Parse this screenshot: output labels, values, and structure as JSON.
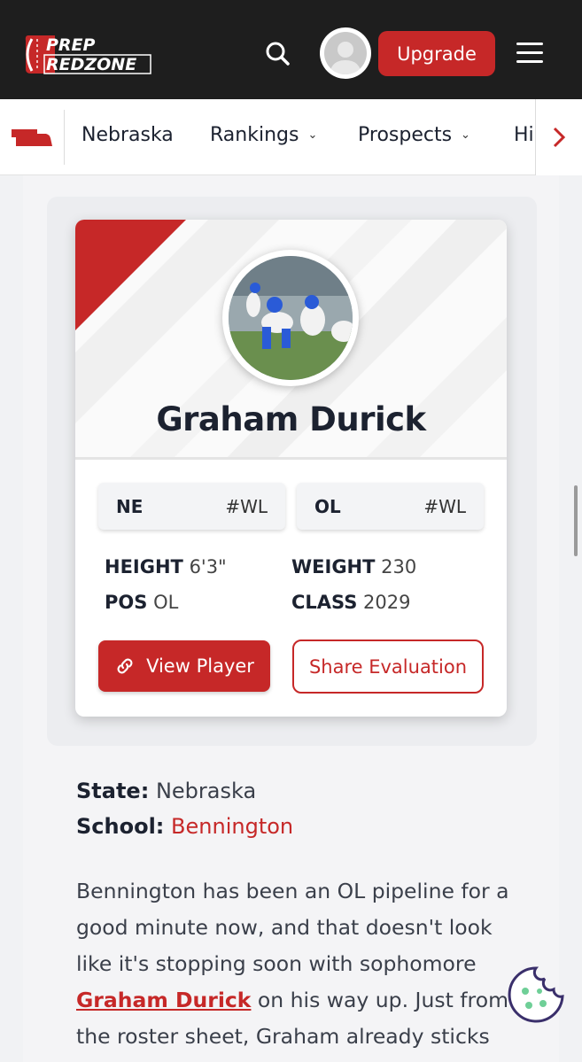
{
  "header": {
    "logo_line1": "PREP",
    "logo_line2": "REDZONE",
    "upgrade_label": "Upgrade",
    "icons": [
      "search-icon",
      "avatar-icon",
      "hamburger-menu-icon"
    ]
  },
  "nav": {
    "items": [
      {
        "label": "Nebraska",
        "has_dropdown": false
      },
      {
        "label": "Rankings",
        "has_dropdown": true
      },
      {
        "label": "Prospects",
        "has_dropdown": true
      },
      {
        "label": "Hi",
        "has_dropdown": false
      }
    ],
    "icons": [
      "nebraska-state-icon",
      "chevron-right-icon"
    ]
  },
  "player": {
    "name": "Graham Durick",
    "chips": [
      {
        "label": "NE",
        "rank": "#WL"
      },
      {
        "label": "OL",
        "rank": "#WL"
      }
    ],
    "stats": {
      "height_label": "HEIGHT",
      "height_value": "6'3\"",
      "weight_label": "WEIGHT",
      "weight_value": "230",
      "pos_label": "POS",
      "pos_value": "OL",
      "class_label": "CLASS",
      "class_value": "2029"
    },
    "view_button": "View Player",
    "share_button": "Share Evaluation"
  },
  "meta": {
    "state_label": "State:",
    "state_value": "Nebraska",
    "school_label": "School:",
    "school_value": "Bennington"
  },
  "article": {
    "line1": "Bennington has been an OL pipeline for a",
    "line2": "good minute now, and that doesn't look",
    "line3": "like it's stopping soon with sophomore",
    "line4_link": "Graham Durick",
    "line4_rest": " on his way up. Just from",
    "line5": "the roster sheet, Graham already sticks"
  },
  "colors": {
    "brand_red": "#c62828",
    "header_bg": "#1e1e1e",
    "text_dark": "#1c2230"
  }
}
